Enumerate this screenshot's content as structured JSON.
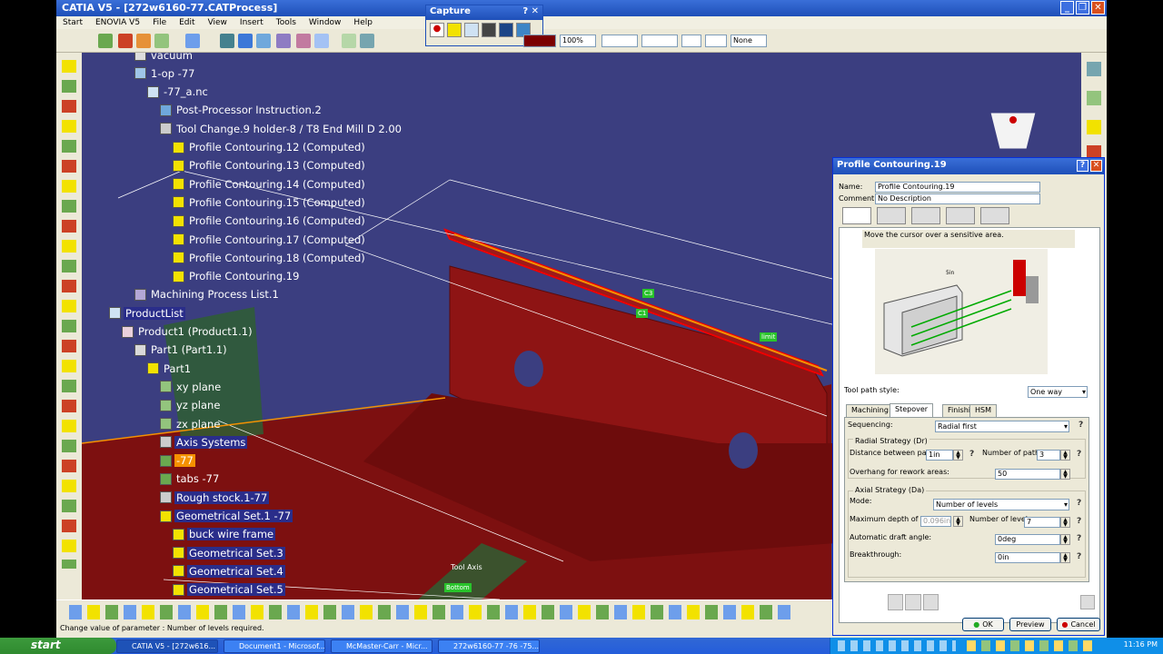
{
  "app": {
    "title": "CATIA V5 - [272w6160-77.CATProcess]"
  },
  "menu": [
    "Start",
    "ENOVIA V5",
    "File",
    "Edit",
    "View",
    "Insert",
    "Tools",
    "Window",
    "Help"
  ],
  "capture_toolbar": {
    "title": "Capture"
  },
  "toolbar_selects": {
    "zoom": "100%",
    "layer": "None"
  },
  "tree": [
    {
      "label": "vacuum",
      "indent": 3,
      "icon": "gear-icon"
    },
    {
      "label": "1-op -77",
      "indent": 3,
      "icon": "operation-icon"
    },
    {
      "label": "-77_a.nc",
      "indent": 4,
      "icon": "file-icon"
    },
    {
      "label": "Post-Processor Instruction.2",
      "indent": 5,
      "icon": "instruction-icon"
    },
    {
      "label": "Tool Change.9  holder-8 / T8 End Mill D 2.00",
      "indent": 5,
      "icon": "tool-change-icon"
    },
    {
      "label": "Profile Contouring.12 (Computed)",
      "indent": 6,
      "icon": "contour-icon"
    },
    {
      "label": "Profile Contouring.13 (Computed)",
      "indent": 6,
      "icon": "contour-icon"
    },
    {
      "label": "Profile Contouring.14 (Computed)",
      "indent": 6,
      "icon": "contour-icon"
    },
    {
      "label": "Profile Contouring.15 (Computed)",
      "indent": 6,
      "icon": "contour-icon"
    },
    {
      "label": "Profile Contouring.16 (Computed)",
      "indent": 6,
      "icon": "contour-icon"
    },
    {
      "label": "Profile Contouring.17 (Computed)",
      "indent": 6,
      "icon": "contour-icon"
    },
    {
      "label": "Profile Contouring.18 (Computed)",
      "indent": 6,
      "icon": "contour-icon"
    },
    {
      "label": "Profile Contouring.19",
      "indent": 6,
      "icon": "contour-icon"
    },
    {
      "label": "Machining Process List.1",
      "indent": 3,
      "icon": "process-list-icon"
    },
    {
      "label": "ProductList",
      "indent": 1,
      "icon": "product-list-icon",
      "hl": "dark"
    },
    {
      "label": "Product1 (Product1.1)",
      "indent": 2,
      "icon": "product-icon"
    },
    {
      "label": "Part1 (Part1.1)",
      "indent": 3,
      "icon": "part-icon"
    },
    {
      "label": "Part1",
      "indent": 4,
      "icon": "part-body-icon"
    },
    {
      "label": "xy plane",
      "indent": 5,
      "icon": "plane-icon"
    },
    {
      "label": "yz plane",
      "indent": 5,
      "icon": "plane-icon"
    },
    {
      "label": "zx plane",
      "indent": 5,
      "icon": "plane-icon"
    },
    {
      "label": "Axis Systems",
      "indent": 5,
      "icon": "axis-icon",
      "hl": "dark"
    },
    {
      "label": "-77",
      "indent": 5,
      "icon": "body-icon",
      "hl": "orange"
    },
    {
      "label": "tabs -77",
      "indent": 5,
      "icon": "body-icon"
    },
    {
      "label": "Rough stock.1-77",
      "indent": 5,
      "icon": "stock-icon",
      "hl": "dark"
    },
    {
      "label": "Geometrical Set.1 -77",
      "indent": 5,
      "icon": "geoset-icon",
      "hl": "dark"
    },
    {
      "label": "buck wire frame",
      "indent": 6,
      "icon": "geoset-icon",
      "hl": "dark"
    },
    {
      "label": "Geometrical Set.3",
      "indent": 6,
      "icon": "geoset-icon",
      "hl": "dark"
    },
    {
      "label": "Geometrical Set.4",
      "indent": 6,
      "icon": "geoset-icon",
      "hl": "dark"
    },
    {
      "label": "Geometrical Set.5",
      "indent": 6,
      "icon": "geoset-icon",
      "hl": "dark"
    }
  ],
  "viewport_labels": {
    "tool_axis": "Tool Axis",
    "bottom": "Bottom",
    "c3": "C3",
    "c1": "C1",
    "limit": "limit"
  },
  "dialog": {
    "title": "Profile Contouring.19",
    "name_label": "Name:",
    "name_value": "Profile Contouring.19",
    "comment_label": "Comment:",
    "comment_value": "No Description",
    "hint": "Move the cursor over a sensitive area.",
    "tool_path_style_label": "Tool path style:",
    "tool_path_style_value": "One way",
    "tabs": [
      "Machining",
      "Stepover",
      "Finishing",
      "HSM"
    ],
    "active_tab": "Stepover",
    "sequencing_label": "Sequencing:",
    "sequencing_value": "Radial first",
    "radial_group": "Radial Strategy (Dr)",
    "dist_label": "Distance between paths:",
    "dist_value": "1in",
    "num_paths_label": "Number of paths:",
    "num_paths_value": "3",
    "overhang_label": "Overhang for rework areas:",
    "overhang_value": "50",
    "axial_group": "Axial Strategy (Da)",
    "mode_label": "Mode:",
    "mode_value": "Number of levels",
    "max_depth_label": "Maximum depth of cut:",
    "max_depth_value": "0.096in",
    "num_levels_label": "Number of levels:",
    "num_levels_value": "7",
    "draft_label": "Automatic draft angle:",
    "draft_value": "0deg",
    "breakthrough_label": "Breakthrough:",
    "breakthrough_value": "0in",
    "ok": "OK",
    "preview": "Preview",
    "cancel": "Cancel",
    "diagram_dim": "5in"
  },
  "status": "Change value of parameter : Number of levels required.",
  "taskbar": {
    "start": "start",
    "tasks": [
      "CATIA V5 - [272w616...",
      "Document1 - Microsof...",
      "McMaster-Carr - Micr...",
      "272w6160-77 -76 -75..."
    ],
    "clock": "11:16 PM"
  }
}
